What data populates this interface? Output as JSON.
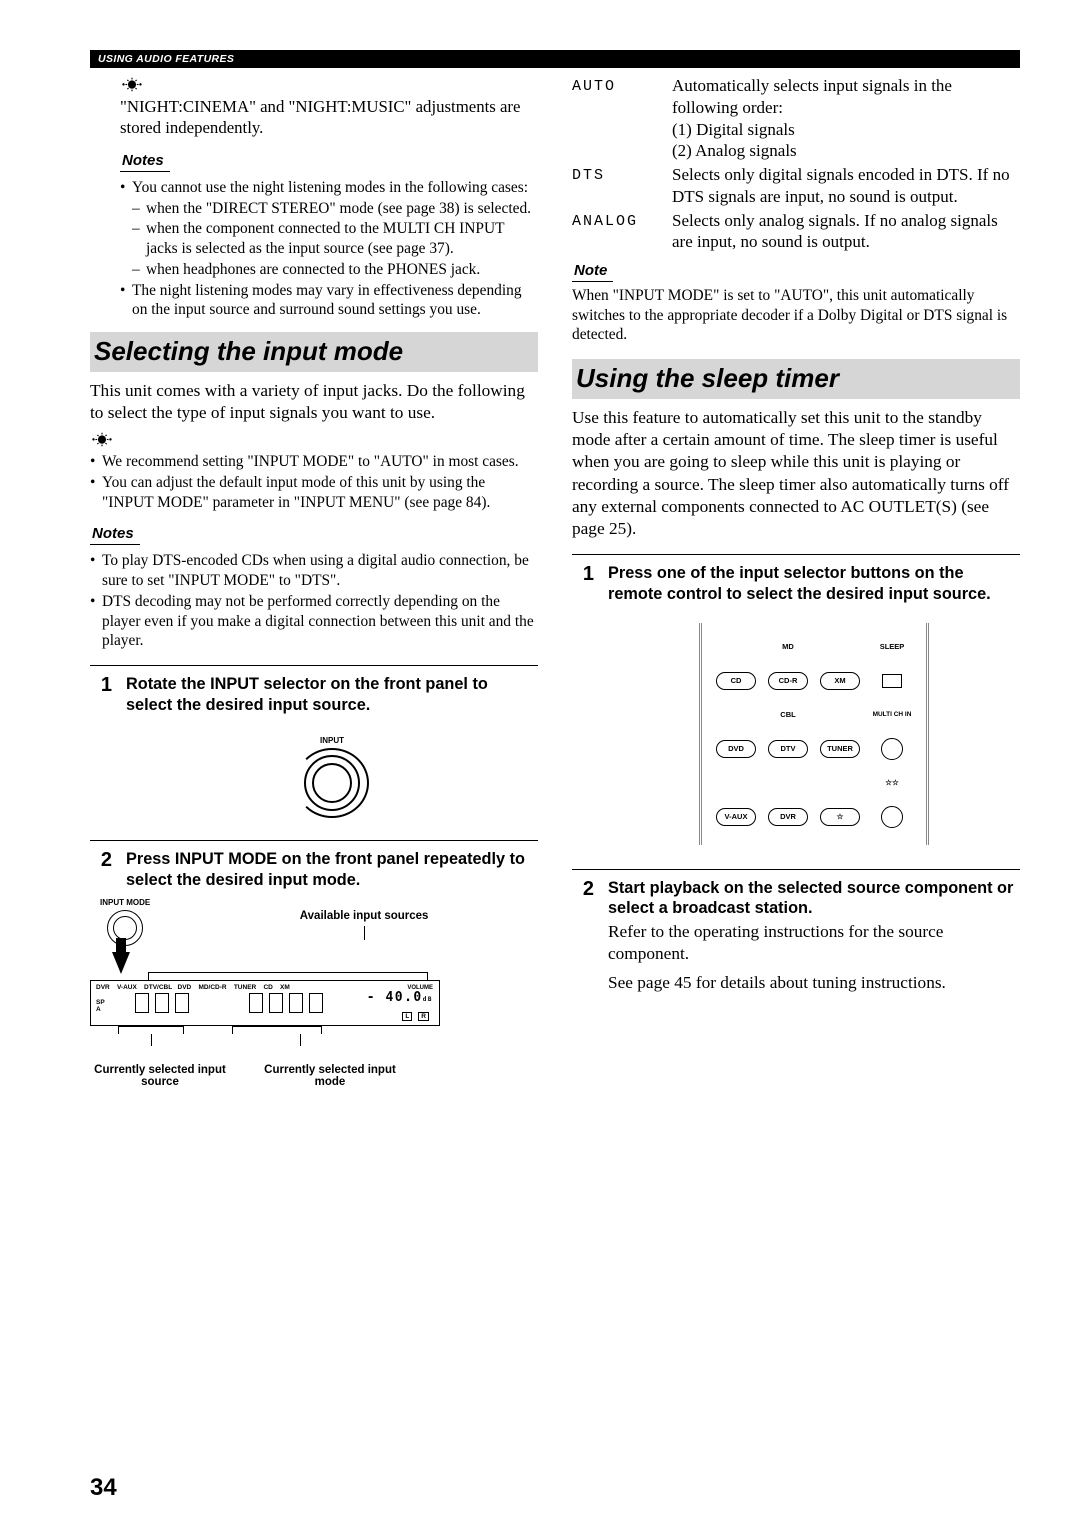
{
  "header": {
    "section": "USING AUDIO FEATURES"
  },
  "left": {
    "tip_intro": "\"NIGHT:CINEMA\" and \"NIGHT:MUSIC\" adjustments are stored independently.",
    "notes1_label": "Notes",
    "notes1": {
      "b1": "You cannot use the night listening modes in the following cases:",
      "s1": "when the \"DIRECT STEREO\" mode (see page 38) is selected.",
      "s2": "when the component connected to the MULTI CH INPUT jacks is selected as the input source (see page 37).",
      "s3": "when headphones are connected to the PHONES jack.",
      "b2": "The night listening modes may vary in effectiveness depending on the input source and surround sound settings you use."
    },
    "heading1": "Selecting the input mode",
    "intro1": "This unit comes with a variety of input jacks. Do the following to select the type of input signals you want to use.",
    "tips": {
      "t1": "We recommend setting \"INPUT MODE\" to \"AUTO\" in most cases.",
      "t2": "You can adjust the default input mode of this unit by using the \"INPUT MODE\" parameter in \"INPUT MENU\" (see page 84)."
    },
    "notes2_label": "Notes",
    "notes2": {
      "b1": "To play DTS-encoded CDs when using a digital audio connection, be sure to set \"INPUT MODE\" to \"DTS\".",
      "b2": "DTS decoding may not be performed correctly depending on the player even if you make a digital connection between this unit and the player."
    },
    "step1": {
      "num": "1",
      "title": "Rotate the INPUT selector on the front panel to select the desired input source.",
      "knob_label": "INPUT"
    },
    "step2": {
      "num": "2",
      "title": "Press INPUT MODE on the front panel repeatedly to select the desired input mode.",
      "knob_label": "INPUT MODE",
      "avail_caption": "Available input sources",
      "sources": "DVR    V-AUX    DTV/CBL   DVD    MD/CD-R    TUNER    CD    XM",
      "sp": "SP\nA",
      "volume_label": "VOLUME",
      "volume_val": "- 40.0",
      "volume_unit": "dB",
      "L": "L",
      "R": "R",
      "cap_src": "Currently selected input source",
      "cap_mode": "Currently selected input mode"
    }
  },
  "right": {
    "modes": {
      "auto_k": "AUTO",
      "auto_d": "Automatically selects input signals in the following order:",
      "auto_d1": "(1) Digital signals",
      "auto_d2": "(2) Analog signals",
      "dts_k": "DTS",
      "dts_d": "Selects only digital signals encoded in DTS. If no DTS signals are input, no sound is output.",
      "analog_k": "ANALOG",
      "analog_d": "Selects only analog signals. If no analog signals are input, no sound is output."
    },
    "note_label": "Note",
    "note_text": "When \"INPUT MODE\" is set to \"AUTO\", this unit automatically switches to the appropriate decoder if a Dolby Digital or DTS signal is detected.",
    "heading2": "Using the sleep timer",
    "sleep_intro": "Use this feature to automatically set this unit to the standby mode after a certain amount of time. The sleep timer is useful when you are going to sleep while this unit is playing or recording a source. The sleep timer also automatically turns off any external components connected to AC OUTLET(S) (see page 25).",
    "step1": {
      "num": "1",
      "title": "Press one of the input selector buttons on the remote control to select the desired input source."
    },
    "remote": {
      "md": "MD",
      "sleep": "SLEEP",
      "cd": "CD",
      "cdr": "CD-R",
      "xm": "XM",
      "cbl": "CBL",
      "multi": "MULTI CH IN",
      "dvd": "DVD",
      "dtv": "DTV",
      "tuner": "TUNER",
      "vaux": "V-AUX",
      "dvr": "DVR",
      "star": "☆",
      "stars": "☆☆"
    },
    "step2": {
      "num": "2",
      "title": "Start playback on the selected source component or select a broadcast station.",
      "body1": "Refer to the operating instructions for the source component.",
      "body2": "See page 45 for details about tuning instructions."
    }
  },
  "page_number": "34"
}
